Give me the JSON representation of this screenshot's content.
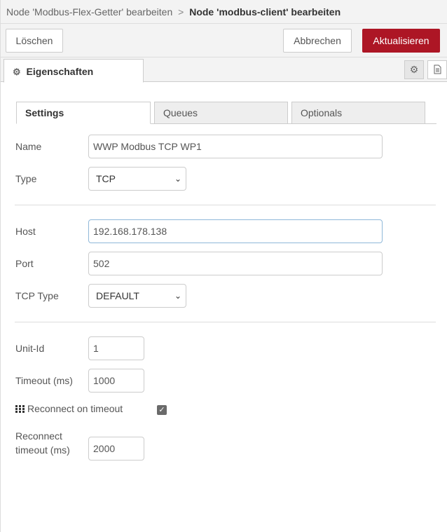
{
  "header": {
    "breadcrumb_parent": "Node 'Modbus-Flex-Getter' bearbeiten",
    "separator": ">",
    "breadcrumb_current": "Node 'modbus-client' bearbeiten"
  },
  "toolbar": {
    "delete_label": "Löschen",
    "cancel_label": "Abbrechen",
    "update_label": "Aktualisieren"
  },
  "tabs": {
    "properties_label": "Eigenschaften",
    "settings_icon": "gear-icon",
    "description_icon": "document-icon"
  },
  "inner_tabs": {
    "settings": "Settings",
    "queues": "Queues",
    "optionals": "Optionals"
  },
  "form": {
    "name_label": "Name",
    "name_value": "WWP Modbus TCP WP1",
    "type_label": "Type",
    "type_value": "TCP",
    "host_label": "Host",
    "host_value": "192.168.178.138",
    "port_label": "Port",
    "port_value": "502",
    "tcp_type_label": "TCP Type",
    "tcp_type_value": "DEFAULT",
    "unit_id_label": "Unit-Id",
    "unit_id_value": "1",
    "timeout_label": "Timeout (ms)",
    "timeout_value": "1000",
    "reconnect_label": "Reconnect on timeout",
    "reconnect_checked": true,
    "reconnect_timeout_label_line1": "Reconnect",
    "reconnect_timeout_label_line2": "timeout (ms)",
    "reconnect_timeout_value": "2000"
  },
  "colors": {
    "primary": "#ad1625",
    "header_bg": "#f3f3f3"
  }
}
